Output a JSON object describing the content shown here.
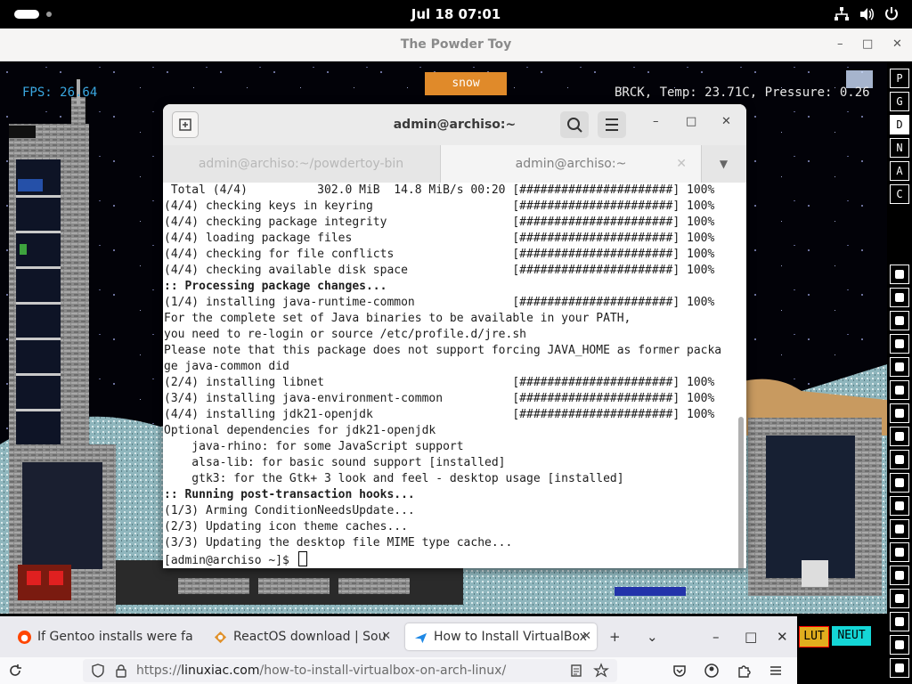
{
  "system": {
    "clock": "Jul 18  07:01",
    "tray_icons": [
      "network-icon",
      "volume-icon",
      "power-icon"
    ]
  },
  "powder_toy": {
    "window_title": "The Powder Toy",
    "fps": "FPS: 26.64",
    "status": "BRCK, Temp: 23.71C, Pressure: 0.26",
    "element_tag": "snow",
    "side_menu": [
      "P",
      "G",
      "D",
      "N",
      "A",
      "C"
    ],
    "bottom_buttons": {
      "lut": "LUT",
      "neut": "NEUT"
    }
  },
  "terminal": {
    "title": "admin@archiso:~",
    "tabs": [
      {
        "label": "admin@archiso:~/powdertoy-bin",
        "active": false
      },
      {
        "label": "admin@archiso:~",
        "active": true
      }
    ],
    "lines": [
      " Total (4/4)          302.0 MiB  14.8 MiB/s 00:20 [######################] 100%",
      "(4/4) checking keys in keyring                    [######################] 100%",
      "(4/4) checking package integrity                  [######################] 100%",
      "(4/4) loading package files                       [######################] 100%",
      "(4/4) checking for file conflicts                 [######################] 100%",
      "(4/4) checking available disk space               [######################] 100%",
      ":: Processing package changes...",
      "(1/4) installing java-runtime-common              [######################] 100%",
      "For the complete set of Java binaries to be available in your PATH,",
      "you need to re-login or source /etc/profile.d/jre.sh",
      "Please note that this package does not support forcing JAVA_HOME as former packa",
      "ge java-common did",
      "(2/4) installing libnet                           [######################] 100%",
      "(3/4) installing java-environment-common          [######################] 100%",
      "(4/4) installing jdk21-openjdk                    [######################] 100%",
      "Optional dependencies for jdk21-openjdk",
      "    java-rhino: for some JavaScript support",
      "    alsa-lib: for basic sound support [installed]",
      "    gtk3: for the Gtk+ 3 look and feel - desktop usage [installed]",
      ":: Running post-transaction hooks...",
      "(1/3) Arming ConditionNeedsUpdate...",
      "(2/3) Updating icon theme caches...",
      "(3/3) Updating the desktop file MIME type cache...",
      "[admin@archiso ~]$ "
    ]
  },
  "browser": {
    "tabs": [
      {
        "label": "If Gentoo installs were fa",
        "icon": "reddit-icon",
        "selected": false
      },
      {
        "label": "ReactOS download | Sou",
        "icon": "reactos-icon",
        "selected": false
      },
      {
        "label": "How to Install VirtualBox",
        "icon": "linuxiac-icon",
        "selected": true
      }
    ],
    "url_prefix": "https://",
    "url_domain": "linuxiac.com",
    "url_path": "/how-to-install-virtualbox-on-arch-linux/",
    "controls": {
      "new_tab": "+",
      "list": "⌄",
      "minimize": "–",
      "maximize": "□",
      "close": "✕"
    }
  }
}
